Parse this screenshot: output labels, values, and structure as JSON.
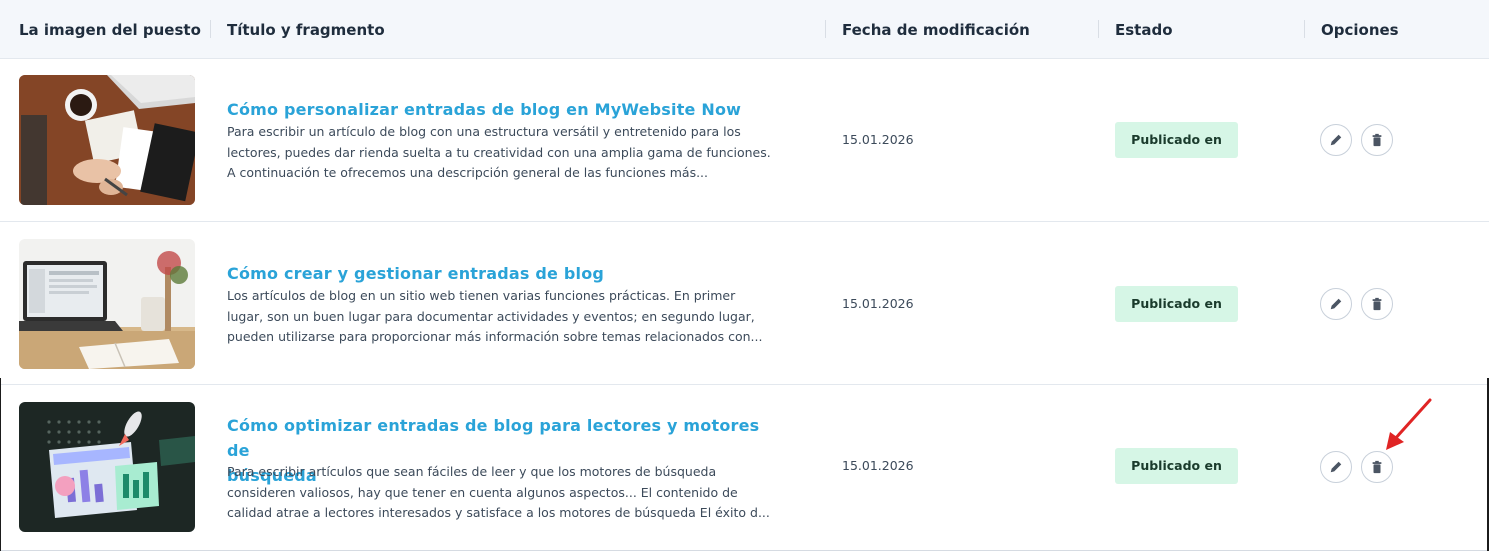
{
  "header": {
    "col_image": "La imagen del puesto",
    "col_title": "Título y fragmento",
    "col_date": "Fecha de modificación",
    "col_status": "Estado",
    "col_options": "Opciones"
  },
  "rows": [
    {
      "title": "Cómo personalizar entradas de blog en MyWebsite Now",
      "excerpt_lines": [
        "Para escribir un artículo de blog con una estructura versátil y entretenido para los",
        "lectores, puedes dar rienda suelta a tu creatividad con una amplia gama de funciones.",
        "A continuación te ofrecemos una descripción general de las funciones más..."
      ],
      "date": "15.01.2026",
      "status": "Publicado en"
    },
    {
      "title": "Cómo crear y gestionar entradas de blog",
      "excerpt_lines": [
        "Los artículos de blog en un sitio web tienen varias funciones prácticas. En primer",
        "lugar, son un buen lugar para documentar actividades y eventos; en segundo lugar,",
        "pueden utilizarse para proporcionar más información sobre temas relacionados con..."
      ],
      "date": "15.01.2026",
      "status": "Publicado en"
    },
    {
      "title_lines": [
        "Cómo optimizar entradas de blog para lectores y motores de",
        "búsqueda"
      ],
      "excerpt_lines": [
        "Para escribir artículos que sean fáciles de leer y que los motores de búsqueda",
        "consideren valiosos, hay que tener en cuenta algunos aspectos... El contenido de",
        "calidad atrae a lectores interesados y satisface a los motores de búsqueda El éxito d..."
      ],
      "date": "15.01.2026",
      "status": "Publicado en"
    }
  ],
  "icons": {
    "edit": "pencil-icon",
    "delete": "trash-icon",
    "annotation": "red-arrow-annotation"
  },
  "colors": {
    "title_link": "#2aa3d8",
    "badge_bg": "#d6f6e6",
    "header_bg": "#f4f7fb",
    "annotation": "#e02424"
  }
}
